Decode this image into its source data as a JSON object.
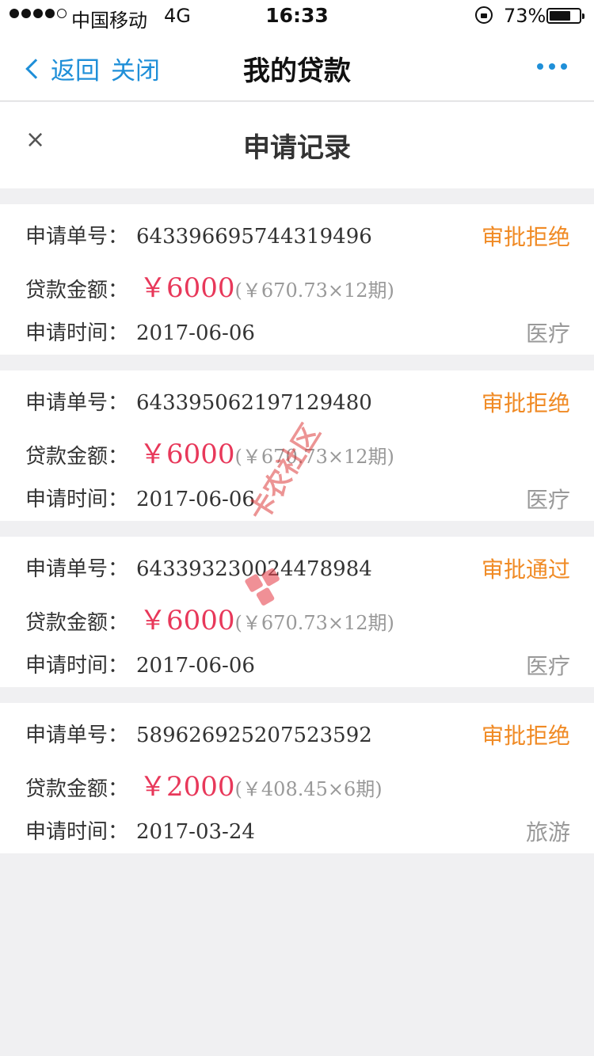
{
  "status_bar": {
    "carrier": "中国移动",
    "network": "4G",
    "time": "16:33",
    "battery": "73%",
    "battery_level": 0.73
  },
  "nav": {
    "back_label": "返回",
    "close_label": "关闭",
    "title": "我的贷款"
  },
  "sheet": {
    "close_symbol": "×",
    "title": "申请记录"
  },
  "labels": {
    "order_no": "申请单号：",
    "amount": "贷款金额：",
    "time": "申请时间："
  },
  "records": [
    {
      "order_no": "643396695744319496",
      "status": "审批拒绝",
      "amount": "￥6000",
      "installment": "(￥670.73×12期)",
      "date": "2017-06-06",
      "purpose": "医疗"
    },
    {
      "order_no": "643395062197129480",
      "status": "审批拒绝",
      "amount": "￥6000",
      "installment": "(￥670.73×12期)",
      "date": "2017-06-06",
      "purpose": "医疗"
    },
    {
      "order_no": "643393230024478984",
      "status": "审批通过",
      "amount": "￥6000",
      "installment": "(￥670.73×12期)",
      "date": "2017-06-06",
      "purpose": "医疗"
    },
    {
      "order_no": "589626925207523592",
      "status": "审批拒绝",
      "amount": "￥2000",
      "installment": "(￥408.45×6期)",
      "date": "2017-03-24",
      "purpose": "旅游"
    }
  ],
  "watermark": "卡农社区",
  "colors": {
    "accent": "#1f8fd8",
    "status": "#f08a24",
    "amount": "#e8385a",
    "muted": "#999999"
  }
}
